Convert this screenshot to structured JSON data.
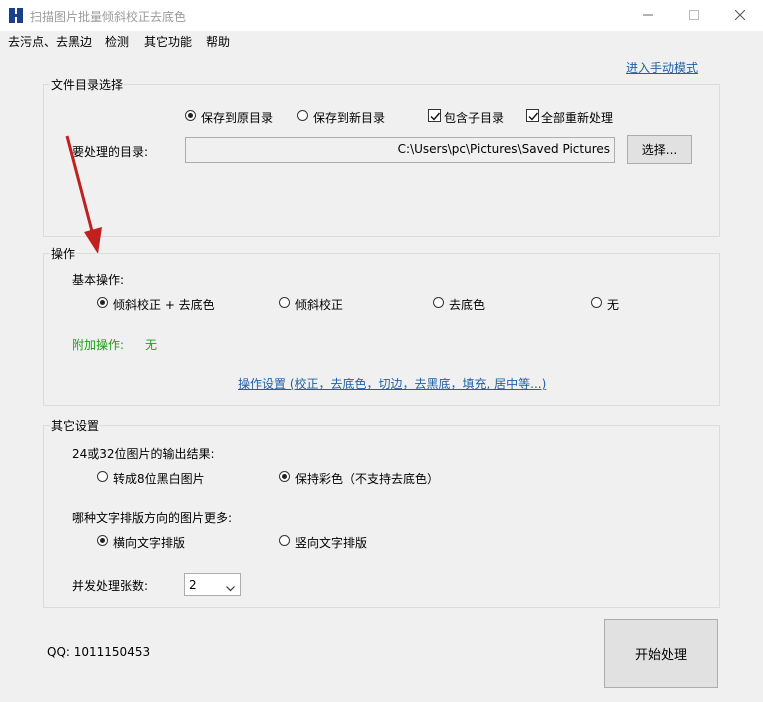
{
  "window": {
    "title": "扫描图片批量倾斜校正去底色"
  },
  "menu": {
    "items": [
      "去污点、去黑边",
      "检测",
      "其它功能",
      "帮助"
    ]
  },
  "manual_mode_link": "进入手动模式",
  "file_dir": {
    "title": "文件目录选择",
    "options": {
      "save_original": "保存到原目录",
      "save_new": "保存到新目录",
      "include_sub": "包含子目录",
      "reprocess_all": "全部重新处理"
    },
    "dir_label": "要处理的目录:",
    "dir_value": "C:\\Users\\pc\\Pictures\\Saved Pictures",
    "choose_button": "选择..."
  },
  "operation": {
    "title": "操作",
    "basic_label": "基本操作:",
    "basic_options": [
      "倾斜校正 + 去底色",
      "倾斜校正",
      "去底色",
      "无"
    ],
    "extra_label": "附加操作:",
    "extra_value": "无",
    "settings_link": "操作设置 (校正，去底色，切边，去黑底，填充, 居中等...)"
  },
  "other": {
    "title": "其它设置",
    "output_label": "24或32位图片的输出结果:",
    "output_options": [
      "转成8位黑白图片",
      "保持彩色（不支持去底色）"
    ],
    "direction_label": "哪种文字排版方向的图片更多:",
    "direction_options": [
      "横向文字排版",
      "竖向文字排版"
    ],
    "concurrency_label": "并发处理张数:",
    "concurrency_value": "2"
  },
  "footer": {
    "qq": "QQ: 1011150453",
    "start_button": "开始处理"
  },
  "colors": {
    "link": "#1f5fa8",
    "extra_green": "#1aa01a",
    "arrow": "#c0201e"
  }
}
